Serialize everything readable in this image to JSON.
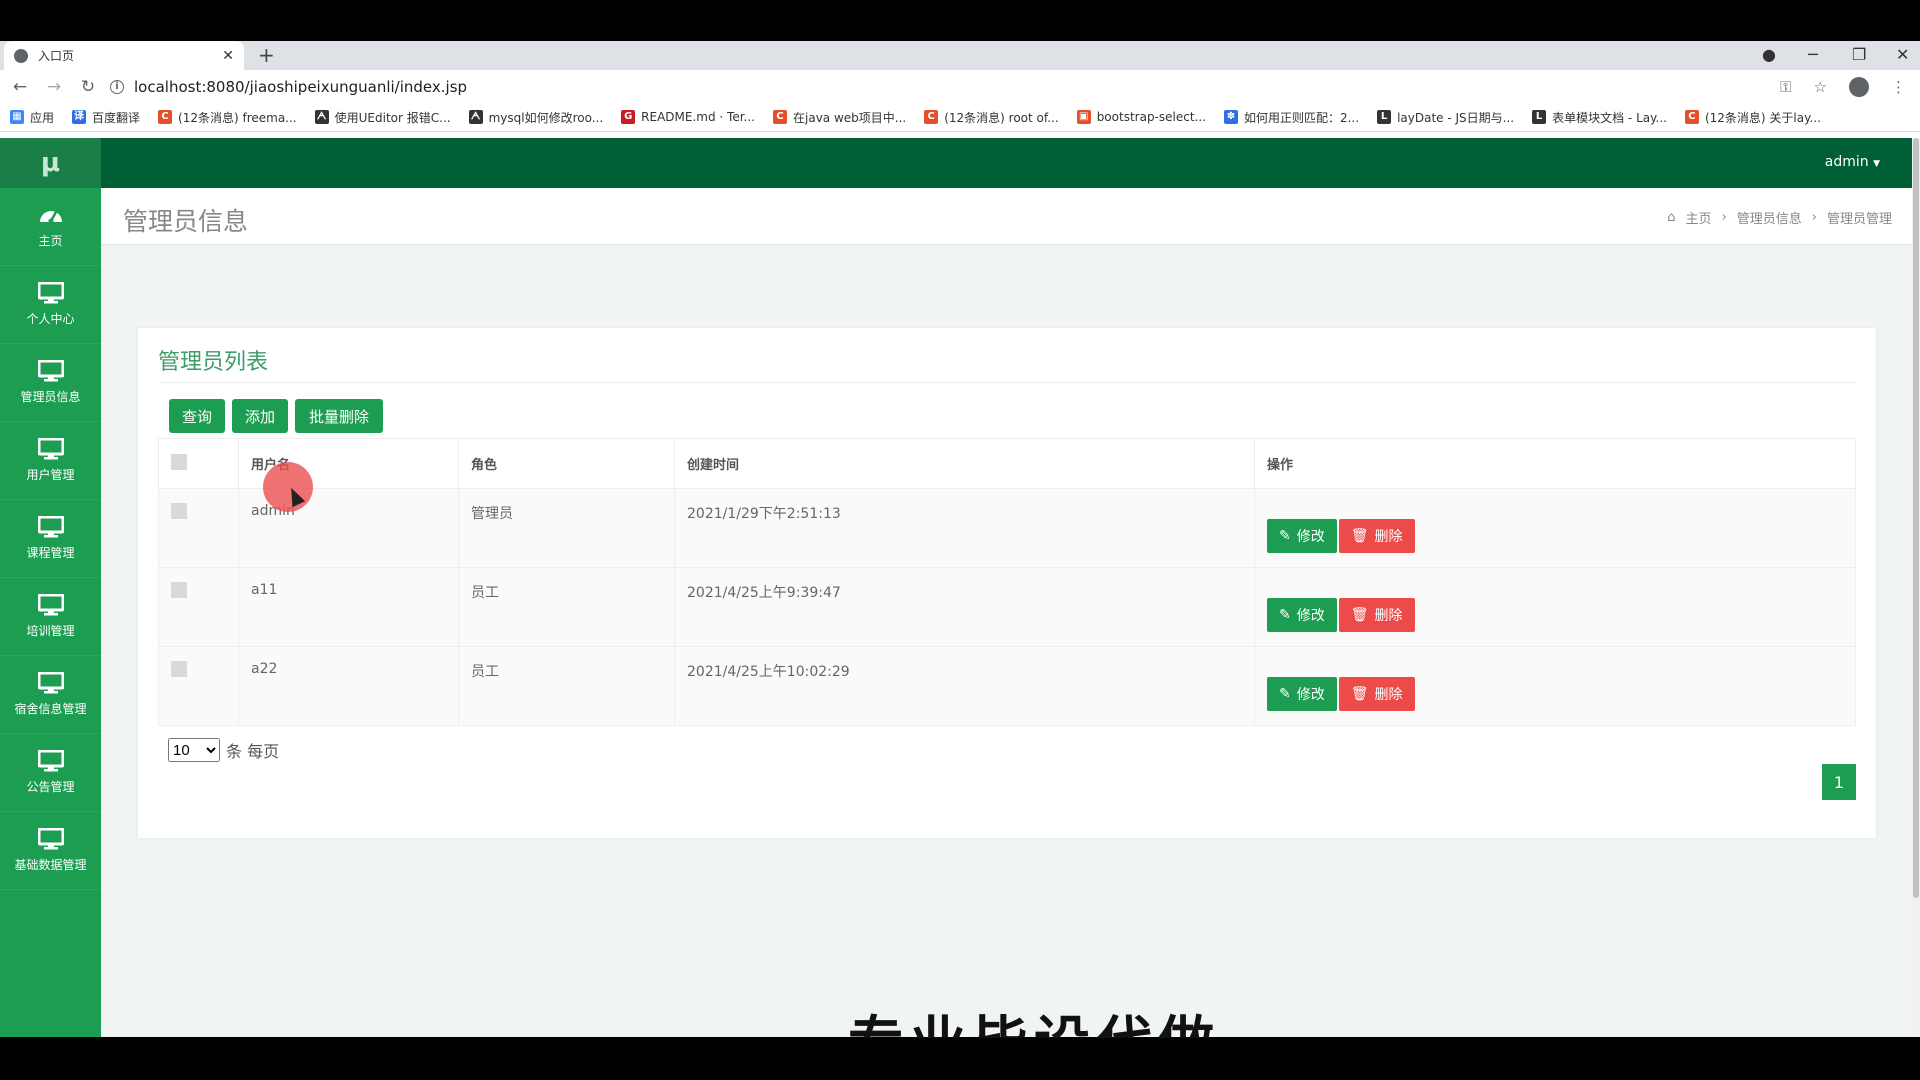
{
  "browser": {
    "tab_title": "入口页",
    "url": "localhost:8080/jiaoshipeixunguanli/index.jsp",
    "bookmarks": [
      {
        "label": "应用",
        "color": "#4285f4",
        "glyph": "▦"
      },
      {
        "label": "百度翻译",
        "color": "#2f6fe4",
        "glyph": "译"
      },
      {
        "label": "(12条消息) freema...",
        "color": "#e4502a",
        "glyph": "C"
      },
      {
        "label": "使用UEditor 报错C...",
        "color": "#333333",
        "glyph": "ᗅ"
      },
      {
        "label": "mysql如何修改roo...",
        "color": "#333333",
        "glyph": "ᗅ"
      },
      {
        "label": "README.md · Ter...",
        "color": "#c71d23",
        "glyph": "G"
      },
      {
        "label": "在java web项目中...",
        "color": "#e4502a",
        "glyph": "C"
      },
      {
        "label": "(12条消息) root of...",
        "color": "#e4502a",
        "glyph": "C"
      },
      {
        "label": "bootstrap-select...",
        "color": "#e4502a",
        "glyph": "▣"
      },
      {
        "label": "如何用正则匹配：2...",
        "color": "#2f6fe4",
        "glyph": "✽"
      },
      {
        "label": "layDate - JS日期与...",
        "color": "#333333",
        "glyph": "L"
      },
      {
        "label": "表单模块文档 - Lay...",
        "color": "#333333",
        "glyph": "L"
      },
      {
        "label": "(12条消息) 关于lay...",
        "color": "#e4502a",
        "glyph": "C"
      }
    ]
  },
  "app": {
    "logo": "μ",
    "user": "admin",
    "sidebar": [
      {
        "label": "主页",
        "icon": "dashboard-icon"
      },
      {
        "label": "个人中心",
        "icon": "monitor-icon"
      },
      {
        "label": "管理员信息",
        "icon": "monitor-icon"
      },
      {
        "label": "用户管理",
        "icon": "monitor-icon"
      },
      {
        "label": "课程管理",
        "icon": "monitor-icon"
      },
      {
        "label": "培训管理",
        "icon": "monitor-icon"
      },
      {
        "label": "宿舍信息管理",
        "icon": "monitor-icon"
      },
      {
        "label": "公告管理",
        "icon": "monitor-icon"
      },
      {
        "label": "基础数据管理",
        "icon": "monitor-icon"
      }
    ],
    "page_title": "管理员信息",
    "breadcrumb": [
      "主页",
      "管理员信息",
      "管理员管理"
    ],
    "card_title": "管理员列表",
    "buttons": {
      "query": "查询",
      "add": "添加",
      "batch_delete": "批量删除"
    },
    "table": {
      "headers": [
        "用户名",
        "角色",
        "创建时间",
        "操作"
      ],
      "rows": [
        {
          "username": "admin",
          "role": "管理员",
          "created": "2021/1/29下午2:51:13"
        },
        {
          "username": "a11",
          "role": "员工",
          "created": "2021/4/25上午9:39:47"
        },
        {
          "username": "a22",
          "role": "员工",
          "created": "2021/4/25上午10:02:29"
        }
      ],
      "edit_label": "修改",
      "delete_label": "删除"
    },
    "pager": {
      "page_size": "10",
      "suffix": "条 每页",
      "current_page": "1"
    },
    "overlay_caption": "专业毕设代做"
  },
  "colors": {
    "primary": "#1d9d52",
    "topbar": "#005f35",
    "danger": "#ed4a4a"
  }
}
